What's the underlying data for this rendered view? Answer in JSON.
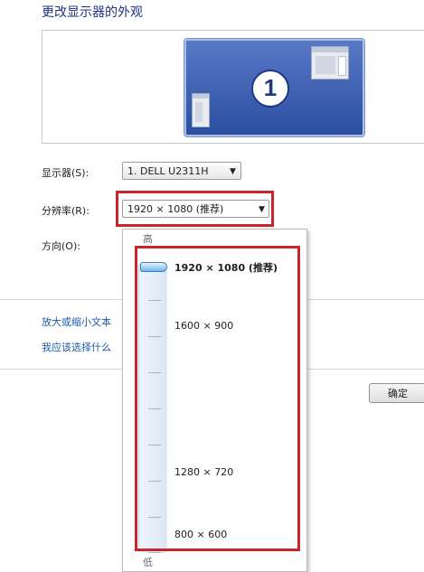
{
  "page": {
    "title": "更改显示器的外观"
  },
  "preview": {
    "monitor_number": "1"
  },
  "form": {
    "display_label": "显示器(S):",
    "display_value": "1. DELL U2311H",
    "resolution_label": "分辨率(R):",
    "resolution_value": "1920 × 1080 (推荐)",
    "orientation_label": "方向(O):"
  },
  "links": {
    "text_size": "放大或缩小文本",
    "which_settings": "我应该选择什么"
  },
  "buttons": {
    "ok": "确定"
  },
  "resolution_popup": {
    "high_label": "高",
    "low_label": "低",
    "options": [
      {
        "label": "1920 × 1080 (推荐)"
      },
      {
        "label": "1600 × 900"
      },
      {
        "label": "1280 × 720"
      },
      {
        "label": "800 × 600"
      }
    ],
    "selected_index": 0
  },
  "colors": {
    "highlight_box": "#c8262b",
    "title_text": "#1e3287",
    "link_text": "#1e5aa8"
  },
  "icons": {
    "caret": "caret-down-icon",
    "monitor": "monitor-icon",
    "slider_thumb": "slider-thumb-icon"
  }
}
